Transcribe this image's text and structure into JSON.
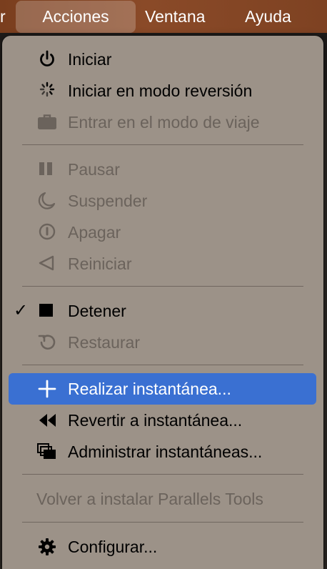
{
  "menubar": {
    "prev_label": "r",
    "active_label": "Acciones",
    "ventana_label": "Ventana",
    "ayuda_label": "Ayuda"
  },
  "menu": {
    "items": [
      {
        "label": "Iniciar",
        "icon": "power-icon",
        "enabled": true
      },
      {
        "label": "Iniciar en modo reversión",
        "icon": "spinner-icon",
        "enabled": true
      },
      {
        "label": "Entrar en el modo de viaje",
        "icon": "briefcase-icon",
        "enabled": false
      },
      {
        "label": "Pausar",
        "icon": "pause-icon",
        "enabled": false
      },
      {
        "label": "Suspender",
        "icon": "moon-icon",
        "enabled": false
      },
      {
        "label": "Apagar",
        "icon": "shutdown-icon",
        "enabled": false
      },
      {
        "label": "Reiniciar",
        "icon": "restart-icon",
        "enabled": false
      },
      {
        "label": "Detener",
        "icon": "stop-icon",
        "enabled": true,
        "checked": true
      },
      {
        "label": "Restaurar",
        "icon": "undo-icon",
        "enabled": false
      },
      {
        "label": "Realizar instantánea...",
        "icon": "plus-icon",
        "enabled": true,
        "highlighted": true
      },
      {
        "label": "Revertir a instantánea...",
        "icon": "rewind-icon",
        "enabled": true
      },
      {
        "label": "Administrar instantáneas...",
        "icon": "stacked-windows-icon",
        "enabled": true
      },
      {
        "label": "Volver a instalar Parallels Tools",
        "enabled": false
      },
      {
        "label": "Configurar...",
        "icon": "gear-icon",
        "enabled": true
      }
    ],
    "check_mark": "✓"
  },
  "colors": {
    "menu_bg": "#9c9288",
    "highlight": "#3a70d2",
    "disabled_text": "#6b635c",
    "menubar_bg": "#7a3e1e"
  }
}
